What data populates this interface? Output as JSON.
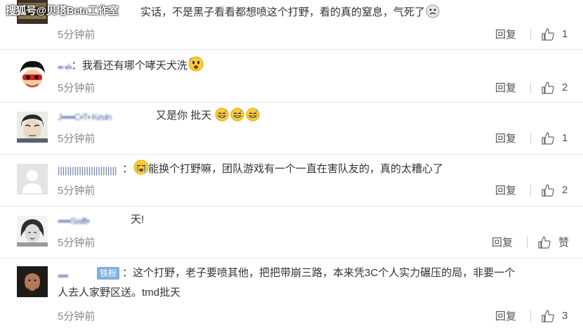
{
  "watermark": "搜狐号@贝塔Beta工作室",
  "comments": [
    {
      "username": "",
      "text": "实话，不是黑子看看都想喷这个打野，看的真的窒息，气死了",
      "time": "5分钟前",
      "reply": "回复",
      "likes": "1",
      "emojis": [
        "angry-face"
      ]
    },
    {
      "username": "▪▪ ▪/▪",
      "separator": "：",
      "text": "我看还有哪个哮天犬洗",
      "time": "5分钟前",
      "reply": "回复",
      "likes": "2",
      "emojis": [
        "fearful-face"
      ]
    },
    {
      "username": "J▪▪▪▪▪C▪T▪ Kevin",
      "text": "又是你 批天",
      "time": "5分钟前",
      "reply": "回复",
      "likes": "1",
      "emojis": [
        "sweat-smile",
        "sweat-smile",
        "sweat-smile"
      ]
    },
    {
      "username": "|||||||||||||||||||||||||",
      "separator": "：",
      "text": "能换个打野嘛，团队游戏有一个一直在害队友的，真的太糟心了",
      "time": "5分钟前",
      "reply": "回复",
      "likes": "2",
      "emojis": [
        "crying-face"
      ]
    },
    {
      "username": "▪▪▪▪▪Swift▪",
      "text": "天!",
      "time": "5分钟前",
      "reply": "回复",
      "likes": "赞",
      "emojis": []
    },
    {
      "username": "▪▪▪▪",
      "badge": "铁粉",
      "separator": "：",
      "text": "这个打野，老子要喷其他，把把带崩三路，本来凭3C个人实力碾压的局，非要一个",
      "text_line2": "人去人家野区送。tmd批天",
      "time": "5分钟前",
      "reply": "回复",
      "likes": "3",
      "emojis": []
    }
  ]
}
